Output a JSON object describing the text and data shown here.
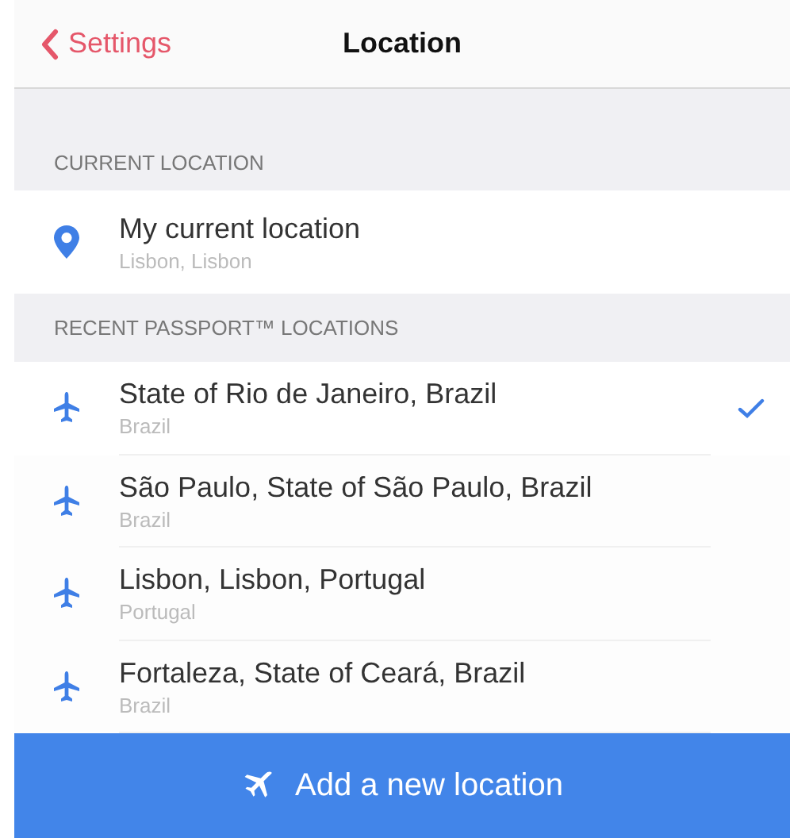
{
  "nav": {
    "back_label": "Settings",
    "title": "Location"
  },
  "current_section": {
    "header": "CURRENT LOCATION",
    "item": {
      "title": "My current location",
      "subtitle": "Lisbon, Lisbon"
    }
  },
  "recent_section": {
    "header": "RECENT PASSPORT™ LOCATIONS",
    "items": [
      {
        "title": "State of Rio de Janeiro, Brazil",
        "subtitle": "Brazil",
        "selected": true
      },
      {
        "title": "São Paulo, State of São Paulo, Brazil",
        "subtitle": "Brazil",
        "selected": false
      },
      {
        "title": "Lisbon, Lisbon, Portugal",
        "subtitle": "Portugal",
        "selected": false
      },
      {
        "title": "Fortaleza, State of Ceará, Brazil",
        "subtitle": "Brazil",
        "selected": false
      }
    ]
  },
  "add_button": {
    "label": "Add a new location"
  }
}
